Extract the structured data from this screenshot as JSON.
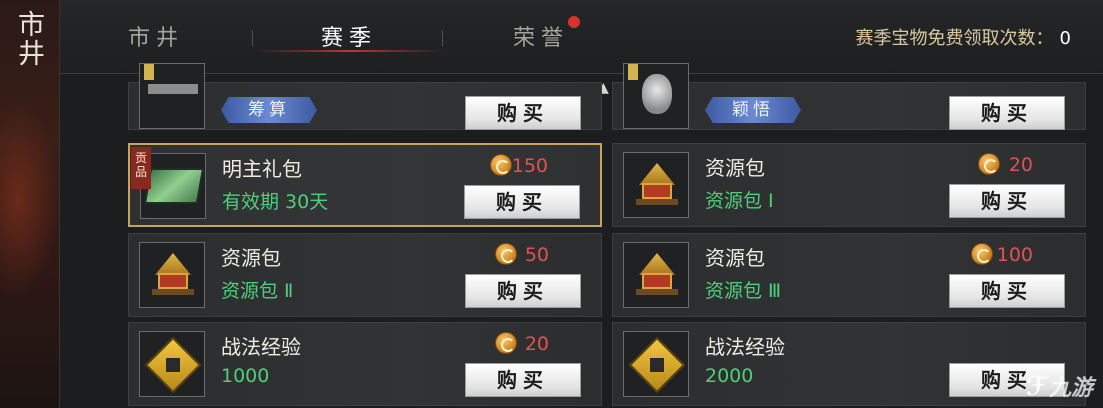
{
  "side": {
    "title": "市井"
  },
  "tabs": [
    {
      "label": "市井",
      "active": false
    },
    {
      "label": "赛季",
      "active": true
    },
    {
      "label": "荣誉",
      "active": false,
      "has_dot": true
    }
  ],
  "header": {
    "free_count_label": "赛季宝物免费领取次数：",
    "free_count_value": "0"
  },
  "items_partial": [
    {
      "skill_tag": "筹算",
      "button": "购买"
    },
    {
      "skill_tag": "颖悟",
      "button": "购买"
    }
  ],
  "items": [
    {
      "name": "明主礼包",
      "sub": "有效期 30天",
      "price": "150",
      "button": "购买",
      "tribute": "贡品",
      "selected": true,
      "icon": "gift-icon"
    },
    {
      "name": "资源包",
      "sub": "资源包 Ⅰ",
      "price": "20",
      "button": "购买",
      "icon": "resource-chest-icon"
    },
    {
      "name": "资源包",
      "sub": "资源包 Ⅱ",
      "price": "50",
      "button": "购买",
      "icon": "resource-chest-icon"
    },
    {
      "name": "资源包",
      "sub": "资源包 Ⅲ",
      "price": "100",
      "button": "购买",
      "icon": "resource-chest-icon"
    },
    {
      "name": "战法经验",
      "sub": "1000",
      "price": "20",
      "button": "购买",
      "icon": "fist-icon"
    },
    {
      "name": "战法经验",
      "sub": "2000",
      "price": "",
      "button": "购买",
      "icon": "fist-icon"
    }
  ],
  "watermark": {
    "text": "九游"
  },
  "colors": {
    "price": "#e05353",
    "sub": "#4fcf7b",
    "selected_border": "#c9a25b",
    "accent_red": "#d9312b"
  }
}
